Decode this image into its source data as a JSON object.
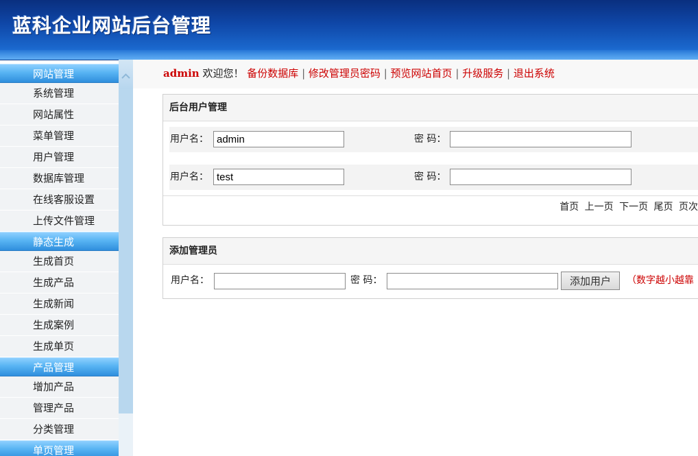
{
  "header": {
    "title": "蓝科企业网站后台管理"
  },
  "sidebar": {
    "sections": [
      {
        "title": "网站管理",
        "items": [
          "系统管理",
          "网站属性",
          "菜单管理",
          "用户管理",
          "数据库管理",
          "在线客服设置",
          "上传文件管理"
        ]
      },
      {
        "title": "静态生成",
        "items": [
          "生成首页",
          "生成产品",
          "生成新闻",
          "生成案例",
          "生成单页"
        ]
      },
      {
        "title": "产品管理",
        "items": [
          "增加产品",
          "管理产品",
          "分类管理"
        ]
      },
      {
        "title": "单页管理",
        "items": []
      }
    ]
  },
  "topbar": {
    "user": "admin",
    "welcome": "欢迎您！",
    "links": [
      "备份数据库",
      "修改管理员密码",
      "预览网站首页",
      "升级服务",
      "退出系统"
    ],
    "separator": "|"
  },
  "users_panel": {
    "title": "后台用户管理",
    "username_label": "用户名：",
    "password_label": "密 码：",
    "users": [
      {
        "username": "admin",
        "password": ""
      },
      {
        "username": "test",
        "password": ""
      }
    ],
    "pager": [
      "首页",
      "上一页",
      "下一页",
      "尾页",
      "页次"
    ]
  },
  "add_panel": {
    "title": "添加管理员",
    "username_label": "用户名：",
    "password_label": "密 码：",
    "username_value": "",
    "password_value": "",
    "button": "添加用户",
    "hint": "（数字越小越靠"
  },
  "colors": {
    "accent_red": "#cc0000",
    "banner_blue": "#0f47a8",
    "sidebar_head": "#4aa6ec"
  }
}
